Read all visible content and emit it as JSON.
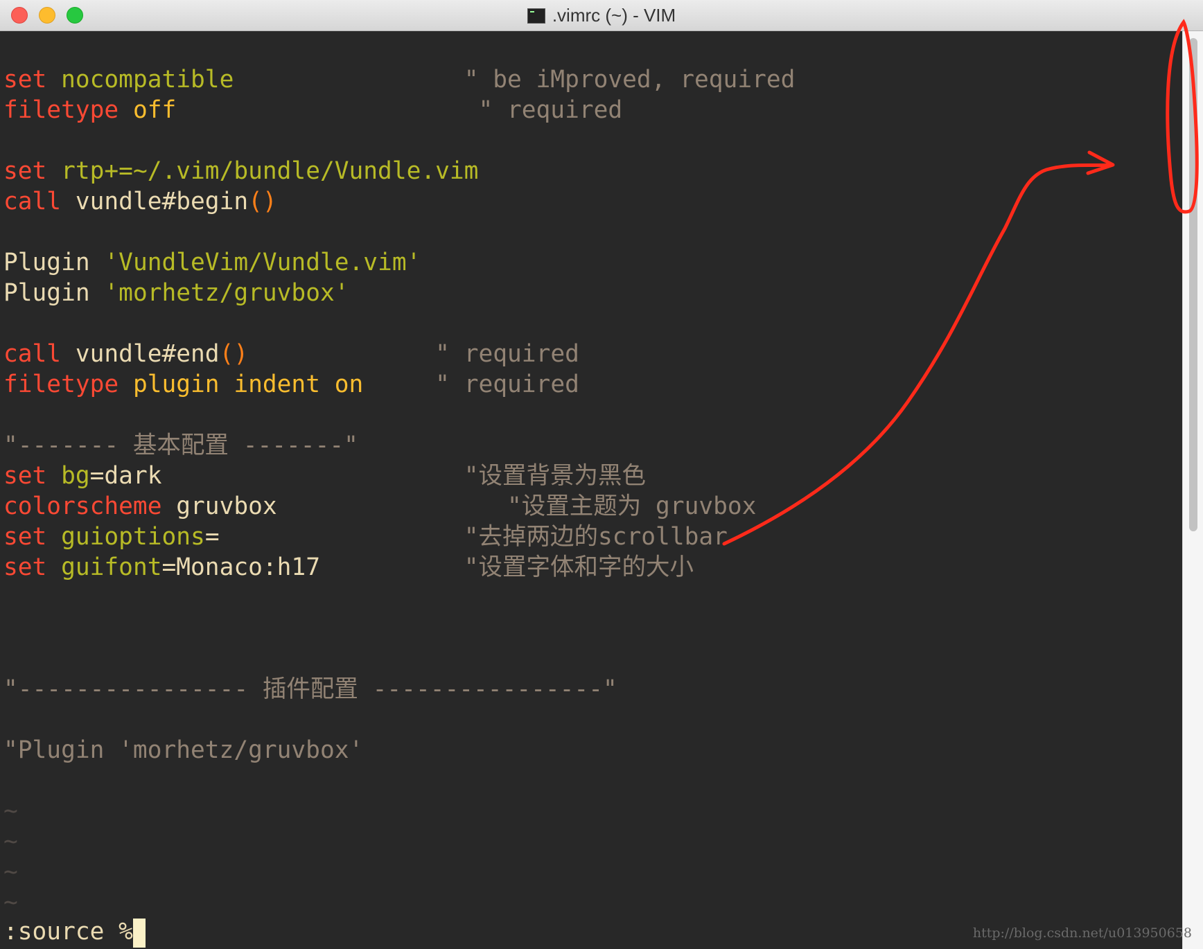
{
  "window": {
    "title": ".vimrc (~) - VIM",
    "icon": "terminal-icon"
  },
  "editor": {
    "l1": {
      "a": "set",
      "b": "nocompatible",
      "c": "\" be iMproved, required"
    },
    "l2": {
      "a": "filetype",
      "b": "off",
      "c": "\" required"
    },
    "l4": {
      "a": "set",
      "b": "rtp+=~/.vim/bundle/Vundle.vim"
    },
    "l5": {
      "a": "call",
      "b": "vundle#begin",
      "c": "()"
    },
    "l7": {
      "a": "Plugin",
      "b": "'VundleVim/Vundle.vim'"
    },
    "l8": {
      "a": "Plugin",
      "b": "'morhetz/gruvbox'"
    },
    "l10": {
      "a": "call",
      "b": "vundle#end",
      "c": "()",
      "d": "\" required"
    },
    "l11": {
      "a": "filetype",
      "b": "plugin indent on",
      "c": "\" required"
    },
    "l13": "\"------- 基本配置 -------\"",
    "l14": {
      "a": "set",
      "b": "bg",
      "c": "=dark",
      "d": "\"设置背景为黑色"
    },
    "l15": {
      "a": "colorscheme",
      "b": "gruvbox",
      "c": "\"设置主题为 gruvbox"
    },
    "l16": {
      "a": "set",
      "b": "guioptions",
      "c": "=",
      "d": "\"去掉两边的scrollbar"
    },
    "l17": {
      "a": "set",
      "b": "guifont",
      "c": "=Monaco:h17",
      "d": "\"设置字体和字的大小"
    },
    "l21": "\"---------------- 插件配置 ----------------\"",
    "l23": "\"Plugin 'morhetz/gruvbox'",
    "tilde": "~",
    "cmdline": ":source %"
  },
  "watermark": "http://blog.csdn.net/u013950658",
  "colors": {
    "background": "#282828",
    "keyword": "#fb4934",
    "option": "#b8bb26",
    "value": "#fabd2f",
    "comment": "#928374",
    "annotation": "#ff2a1a"
  }
}
